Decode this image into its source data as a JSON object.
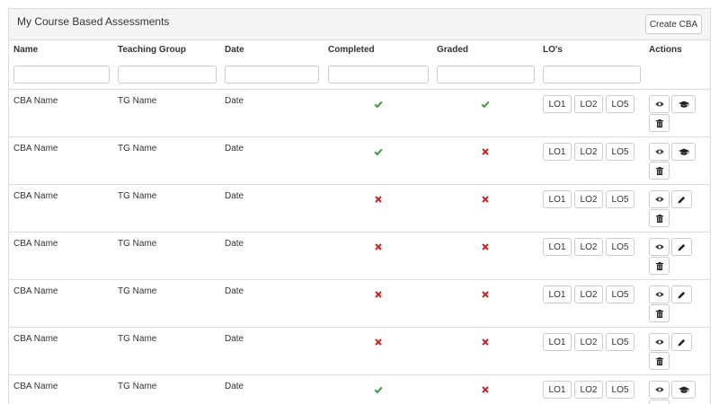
{
  "panel": {
    "title": "My Course Based Assessments",
    "create_label": "Create CBA"
  },
  "columns": [
    "Name",
    "Teaching Group",
    "Date",
    "Completed",
    "Graded",
    "LO's",
    "Actions"
  ],
  "filters": {
    "name": "",
    "teaching_group": "",
    "date": "",
    "completed": "",
    "graded": "",
    "los": ""
  },
  "rows": [
    {
      "name": "CBA Name",
      "group": "TG Name",
      "date": "Date",
      "completed": true,
      "graded": true,
      "los": [
        "LO1",
        "LO2",
        "LO5"
      ],
      "second_action": "graduation-cap"
    },
    {
      "name": "CBA Name",
      "group": "TG Name",
      "date": "Date",
      "completed": true,
      "graded": false,
      "los": [
        "LO1",
        "LO2",
        "LO5"
      ],
      "second_action": "graduation-cap"
    },
    {
      "name": "CBA Name",
      "group": "TG Name",
      "date": "Date",
      "completed": false,
      "graded": false,
      "los": [
        "LO1",
        "LO2",
        "LO5"
      ],
      "second_action": "pencil"
    },
    {
      "name": "CBA Name",
      "group": "TG Name",
      "date": "Date",
      "completed": false,
      "graded": false,
      "los": [
        "LO1",
        "LO2",
        "LO5"
      ],
      "second_action": "pencil"
    },
    {
      "name": "CBA Name",
      "group": "TG Name",
      "date": "Date",
      "completed": false,
      "graded": false,
      "los": [
        "LO1",
        "LO2",
        "LO5"
      ],
      "second_action": "pencil"
    },
    {
      "name": "CBA Name",
      "group": "TG Name",
      "date": "Date",
      "completed": false,
      "graded": false,
      "los": [
        "LO1",
        "LO2",
        "LO5"
      ],
      "second_action": "pencil"
    },
    {
      "name": "CBA Name",
      "group": "TG Name",
      "date": "Date",
      "completed": true,
      "graded": false,
      "los": [
        "LO1",
        "LO2",
        "LO5"
      ],
      "second_action": "graduation-cap"
    }
  ],
  "icons": {
    "check": "check-icon",
    "cross": "cross-icon",
    "view": "eye-icon",
    "delete": "trash-icon"
  },
  "colors": {
    "check": "#3c9a3c",
    "cross": "#cc2222"
  }
}
